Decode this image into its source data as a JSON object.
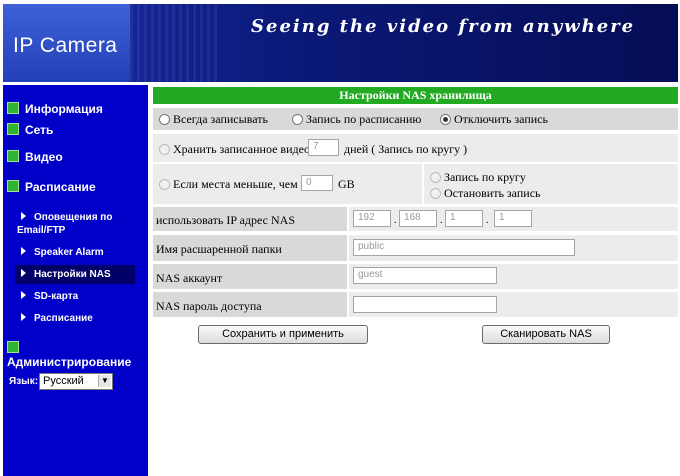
{
  "header": {
    "logo": "IP Camera",
    "slogan": "Seeing the video from anywhere"
  },
  "sidebar": {
    "items": [
      {
        "label": "Информация"
      },
      {
        "label": "Сеть"
      },
      {
        "label": "Видео"
      },
      {
        "label": "Расписание"
      },
      {
        "label": "Администрирование"
      }
    ],
    "subitems": [
      {
        "label": "Оповещения по Email/FTP"
      },
      {
        "label": "Speaker Alarm"
      },
      {
        "label": "Настройки NAS"
      },
      {
        "label": "SD-карта"
      },
      {
        "label": "Расписание"
      }
    ],
    "language_label": "Язык:",
    "language_value": "Русский"
  },
  "main": {
    "title": "Настройки NAS хранилища",
    "record_options": {
      "always": "Всегда записывать",
      "schedule": "Запись по расписанию",
      "disable": "Отключить запись"
    },
    "keep_label": "Хранить записанное видео",
    "keep_value": "7",
    "keep_suffix": "дней ( Запись по кругу )",
    "space_label": "Если места меньше, чем",
    "space_value": "0",
    "space_unit": "GB",
    "loop_option": "Запись по кругу",
    "stop_option": "Остановить запись",
    "ip_label": "использовать IP адрес NAS",
    "ip": [
      "192",
      "168",
      "1",
      "1"
    ],
    "folder_label": "Имя расшаренной папки",
    "folder_value": "public",
    "account_label": "NAS аккаунт",
    "account_value": "guest",
    "password_label": "NAS пароль доступа",
    "password_value": "",
    "save_button": "Сохранить и применить",
    "scan_button": "Сканировать NAS"
  },
  "colors": {
    "sidebar_bg": "#0000c8",
    "title_bar": "#22aa22",
    "header_bg": "#0b1a7a"
  }
}
